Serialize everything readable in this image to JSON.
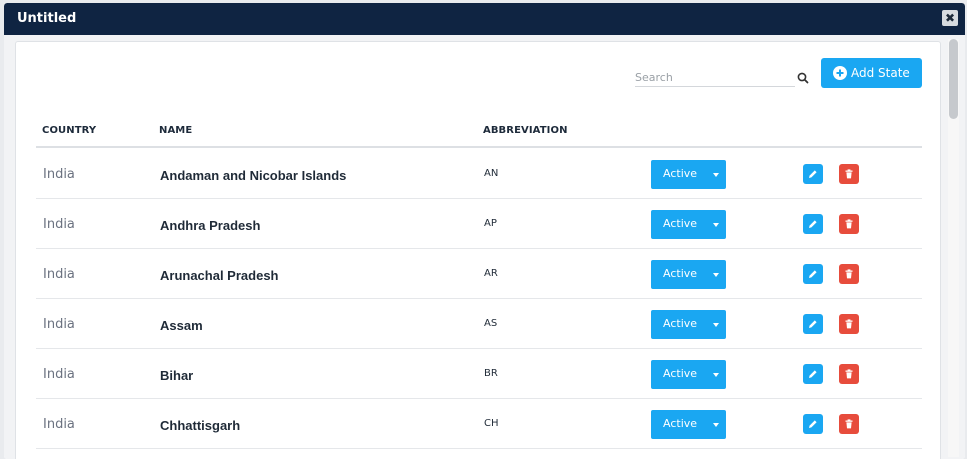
{
  "window": {
    "title": "Untitled",
    "close_glyph": "✖"
  },
  "toolbar": {
    "search_placeholder": "Search",
    "add_label": "Add State"
  },
  "table": {
    "headers": {
      "country": "COUNTRY",
      "name": "NAME",
      "abbreviation": "ABBREVIATION"
    },
    "rows": [
      {
        "country": "India",
        "name": "Andaman and Nicobar Islands",
        "abbreviation": "AN",
        "status": "Active"
      },
      {
        "country": "India",
        "name": "Andhra Pradesh",
        "abbreviation": "AP",
        "status": "Active"
      },
      {
        "country": "India",
        "name": "Arunachal Pradesh",
        "abbreviation": "AR",
        "status": "Active"
      },
      {
        "country": "India",
        "name": "Assam",
        "abbreviation": "AS",
        "status": "Active"
      },
      {
        "country": "India",
        "name": "Bihar",
        "abbreviation": "BR",
        "status": "Active"
      },
      {
        "country": "India",
        "name": "Chhattisgarh",
        "abbreviation": "CH",
        "status": "Active"
      }
    ]
  },
  "icons": {
    "search": "search-icon",
    "add": "plus-circle-icon",
    "edit": "pencil-icon",
    "delete": "trash-icon",
    "close": "close-icon",
    "caret": "caret-down-icon"
  },
  "colors": {
    "titlebar": "#0f2442",
    "primary": "#1aa7f2",
    "danger": "#e74c3c"
  }
}
